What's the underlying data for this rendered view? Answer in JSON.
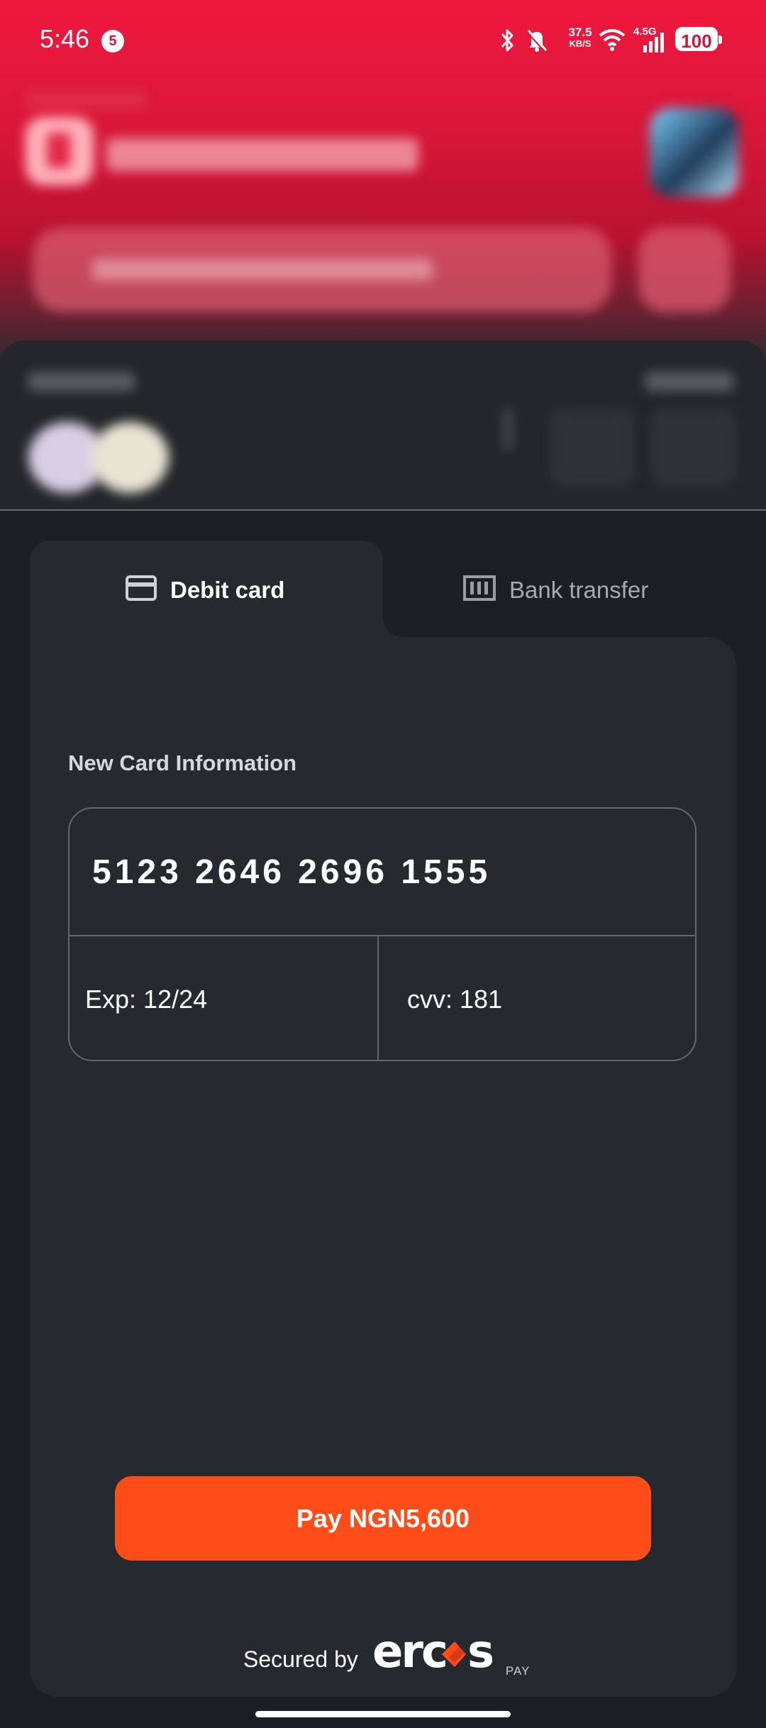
{
  "status_bar": {
    "time": "5:46",
    "notification_count": "5",
    "net_speed_value": "37.5",
    "net_speed_unit": "KB/S",
    "network_type": "4.5G",
    "battery": "100",
    "icons": [
      "bluetooth-icon",
      "bell-muted-icon",
      "wifi-icon",
      "cell-signal-icon"
    ]
  },
  "tabs": [
    {
      "label": "Debit card",
      "icon": "credit-card-icon",
      "active": true
    },
    {
      "label": "Bank transfer",
      "icon": "bank-icon",
      "active": false
    }
  ],
  "card_form": {
    "section_title": "New Card Information",
    "card_number": "5123 2646 2696 1555",
    "expiry": "Exp: 12/24",
    "cvv": "cvv: 181"
  },
  "pay_button": {
    "label": "Pay NGN5,600"
  },
  "footer": {
    "secured_by": "Secured by",
    "brand": "ercas",
    "brand_suffix": "PAY"
  },
  "colors": {
    "accent": "#ff4d19",
    "brand_red": "#f0183d",
    "panel": "#262930",
    "background": "#1b1e23"
  }
}
